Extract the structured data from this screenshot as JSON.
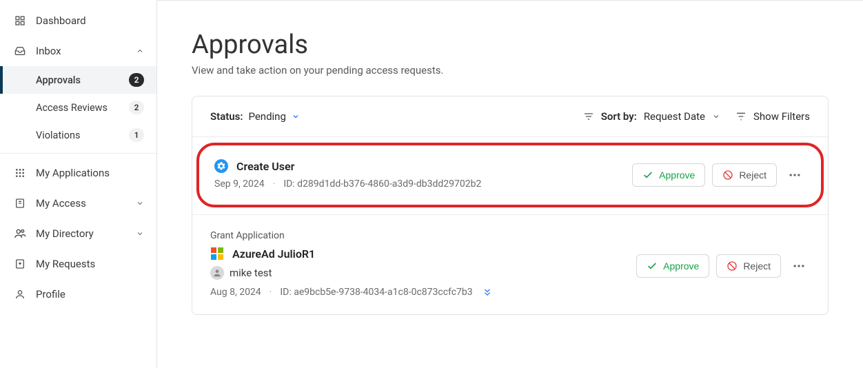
{
  "sidebar": {
    "items": [
      {
        "label": "Dashboard"
      },
      {
        "label": "Inbox"
      },
      {
        "label": "Approvals",
        "badge": "2"
      },
      {
        "label": "Access Reviews",
        "badge": "2"
      },
      {
        "label": "Violations",
        "badge": "1"
      },
      {
        "label": "My Applications"
      },
      {
        "label": "My Access"
      },
      {
        "label": "My Directory"
      },
      {
        "label": "My Requests"
      },
      {
        "label": "Profile"
      }
    ]
  },
  "page": {
    "title": "Approvals",
    "subtitle": "View and take action on your pending access requests."
  },
  "toolbar": {
    "status_label": "Status:",
    "status_value": "Pending",
    "sort_label": "Sort by:",
    "sort_value": "Request Date",
    "show_filters": "Show Filters"
  },
  "requests": [
    {
      "title": "Create User",
      "date": "Sep 9, 2024",
      "id_label": "ID: d289d1dd-b376-4860-a3d9-db3dd29702b2",
      "approve": "Approve",
      "reject": "Reject"
    },
    {
      "category": "Grant Application",
      "title": "AzureAd JulioR1",
      "user": "mike test",
      "date": "Aug 8, 2024",
      "id_label": "ID: ae9bcb5e-9738-4034-a1c8-0c873ccfc7b3",
      "approve": "Approve",
      "reject": "Reject"
    }
  ]
}
